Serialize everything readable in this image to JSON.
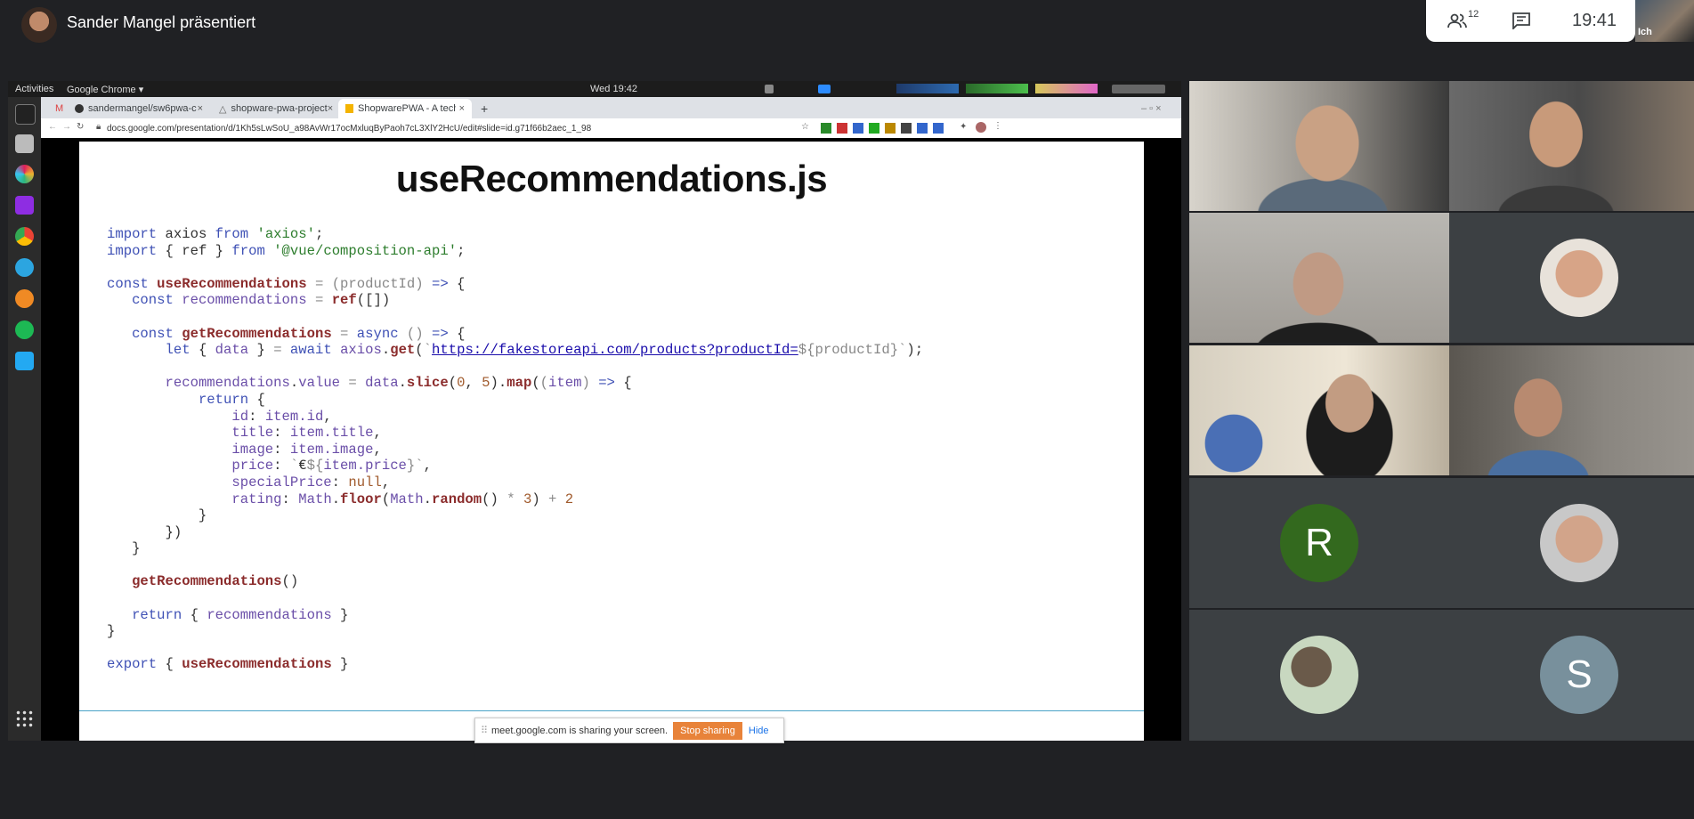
{
  "meet": {
    "presenter_title": "Sander Mangel präsentiert",
    "participant_count": "12",
    "clock": "19:41",
    "self_label": "Ich",
    "tiles": [
      {
        "type": "letter",
        "letter": "R",
        "color": "#33691e"
      },
      {
        "type": "letter",
        "letter": "S",
        "color": "#78909c"
      }
    ]
  },
  "desktop": {
    "activities": "Activities",
    "app_menu": "Google Chrome ▾",
    "datetime": "Wed 19:42"
  },
  "browser": {
    "tabs": [
      {
        "label": "sandermangel/sw6pwa-c",
        "close": "×"
      },
      {
        "label": "shopware-pwa-project",
        "close": "×"
      },
      {
        "label": "ShopwarePWA - A technic",
        "close": "×"
      }
    ],
    "new_tab": "+",
    "url": "docs.google.com/presentation/d/1Kh5sLwSoU_a98AvWr17ocMxluqByPaoh7cL3XlY2HcU/edit#slide=id.g71f66b2aec_1_98"
  },
  "slide": {
    "title": "useRecommendations.js",
    "link_url": "https://fakestoreapi.com/products?productId="
  },
  "share_banner": {
    "text": "meet.google.com is sharing your screen.",
    "stop": "Stop sharing",
    "hide": "Hide"
  }
}
